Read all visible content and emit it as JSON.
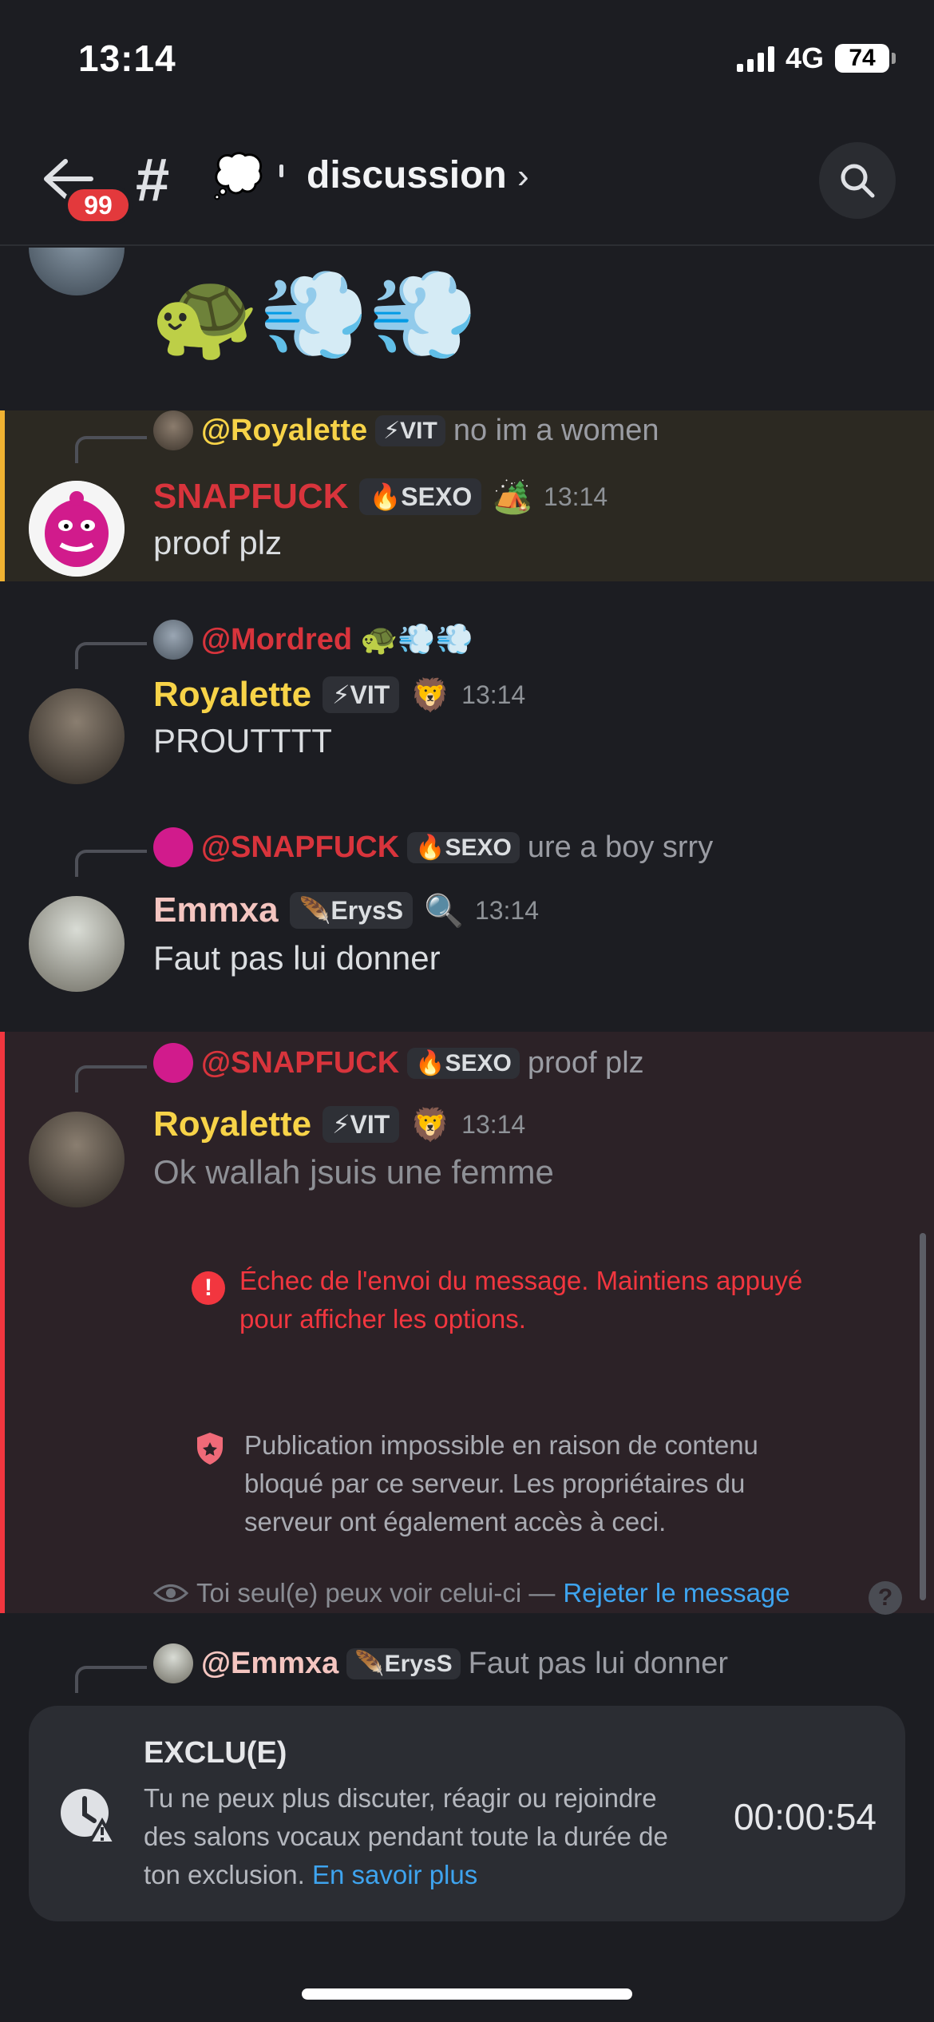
{
  "status": {
    "time": "13:14",
    "network": "4G",
    "battery": "74"
  },
  "header": {
    "unread_count": "99",
    "channel_emoji": "💭",
    "channel_name": "discussion"
  },
  "top_message": {
    "emojis": "🐢💨💨"
  },
  "messages": [
    {
      "reply": {
        "name": "@Royalette",
        "tag": "⚡VIT",
        "text": "no im a women"
      },
      "author": "SNAPFUCK",
      "tag": "🔥SEXO",
      "badge_emoji": "🏕️",
      "time": "13:14",
      "text": "proof plz",
      "highlight": "#2c2922"
    },
    {
      "reply": {
        "name": "@Mordred",
        "emojis": "🐢💨💨"
      },
      "author": "Royalette",
      "tag": "⚡VIT",
      "badge_emoji": "🦁",
      "time": "13:14",
      "text": "PROUTTTT"
    },
    {
      "reply": {
        "name": "@SNAPFUCK",
        "tag": "🔥SEXO",
        "text": "ure a boy srry"
      },
      "author": "Emmxa",
      "tag": "🪶ErysS",
      "badge_emoji": "🔍",
      "time": "13:14",
      "text": "Faut pas lui donner"
    },
    {
      "reply": {
        "name": "@SNAPFUCK",
        "tag": "🔥SEXO",
        "text": "proof plz"
      },
      "author": "Royalette",
      "tag": "⚡VIT",
      "badge_emoji": "🦁",
      "time": "13:14",
      "text": "Ok wallah jsuis une femme",
      "highlight": "#2c2227",
      "error": "Échec de l'envoi du message. Maintiens appuyé pour afficher les options.",
      "blocked": "Publication impossible en raison de contenu bloqué par ce serveur. Les propriétaires du serveur ont également accès à ceci.",
      "only_you": "Toi seul(e) peux voir celui-ci —",
      "dismiss": "Rejeter le message"
    },
    {
      "reply": {
        "name": "@Emmxa",
        "tag": "🪶ErysS",
        "text": "Faut pas lui donner"
      }
    }
  ],
  "timeout": {
    "title": "EXCLU(E)",
    "text": "Tu ne peux plus discuter, réagir ou rejoindre des salons vocaux pendant toute la durée de ton exclusion.",
    "link": "En savoir plus",
    "timer": "00:00:54"
  },
  "colors": {
    "accent_link": "#3ea4ef",
    "error": "#f2363f",
    "royalette": "#f7d348",
    "snapfuck": "#d8343c",
    "emmxa": "#f4c5c0"
  }
}
